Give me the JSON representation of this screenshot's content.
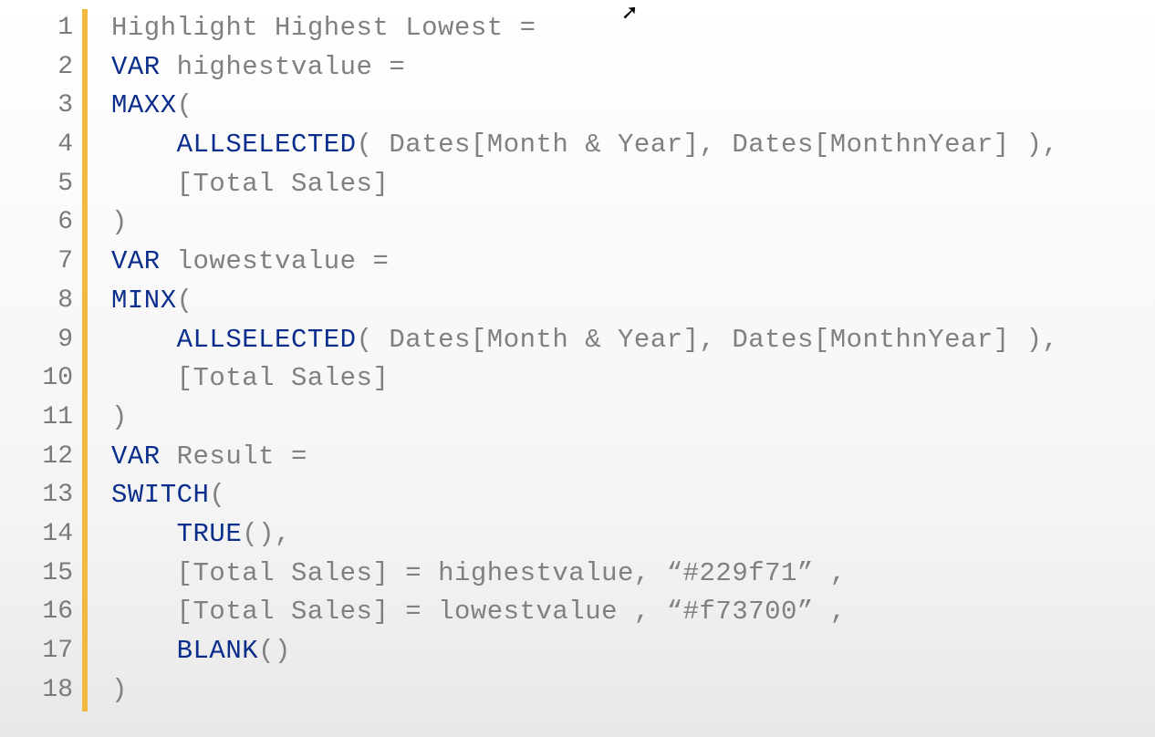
{
  "editor": {
    "line_numbers": [
      "1",
      "2",
      "3",
      "4",
      "5",
      "6",
      "7",
      "8",
      "9",
      "10",
      "11",
      "12",
      "13",
      "14",
      "15",
      "16",
      "17",
      "18"
    ],
    "code": {
      "l1": {
        "t1": "Highlight Highest Lowest ="
      },
      "l2": {
        "kw": "VAR",
        "rest": " highestvalue ="
      },
      "l3": {
        "fn": "MAXX",
        "rest": "("
      },
      "l4": {
        "pad": "    ",
        "fn": "ALLSELECTED",
        "rest": "( Dates[Month & Year], Dates[MonthnYear] ),"
      },
      "l5": {
        "pad": "    ",
        "rest": "[Total Sales]"
      },
      "l6": {
        "rest": ")"
      },
      "l7": {
        "kw": "VAR",
        "rest": " lowestvalue ="
      },
      "l8": {
        "fn": "MINX",
        "rest": "("
      },
      "l9": {
        "pad": "    ",
        "fn": "ALLSELECTED",
        "rest": "( Dates[Month & Year], Dates[MonthnYear] ),"
      },
      "l10": {
        "pad": "    ",
        "rest": "[Total Sales]"
      },
      "l11": {
        "rest": ")"
      },
      "l12": {
        "kw": "VAR",
        "rest": " Result ="
      },
      "l13": {
        "fn": "SWITCH",
        "rest": "("
      },
      "l14": {
        "pad": "    ",
        "fn": "TRUE",
        "rest": "(),"
      },
      "l15": {
        "pad": "    ",
        "rest": "[Total Sales] = highestvalue, “#229f71” ,"
      },
      "l16": {
        "pad": "    ",
        "rest": "[Total Sales] = lowestvalue , “#f73700” ,"
      },
      "l17": {
        "pad": "    ",
        "fn": "BLANK",
        "rest": "()"
      },
      "l18": {
        "rest": ")"
      }
    }
  },
  "cursor_glyph": "➚"
}
